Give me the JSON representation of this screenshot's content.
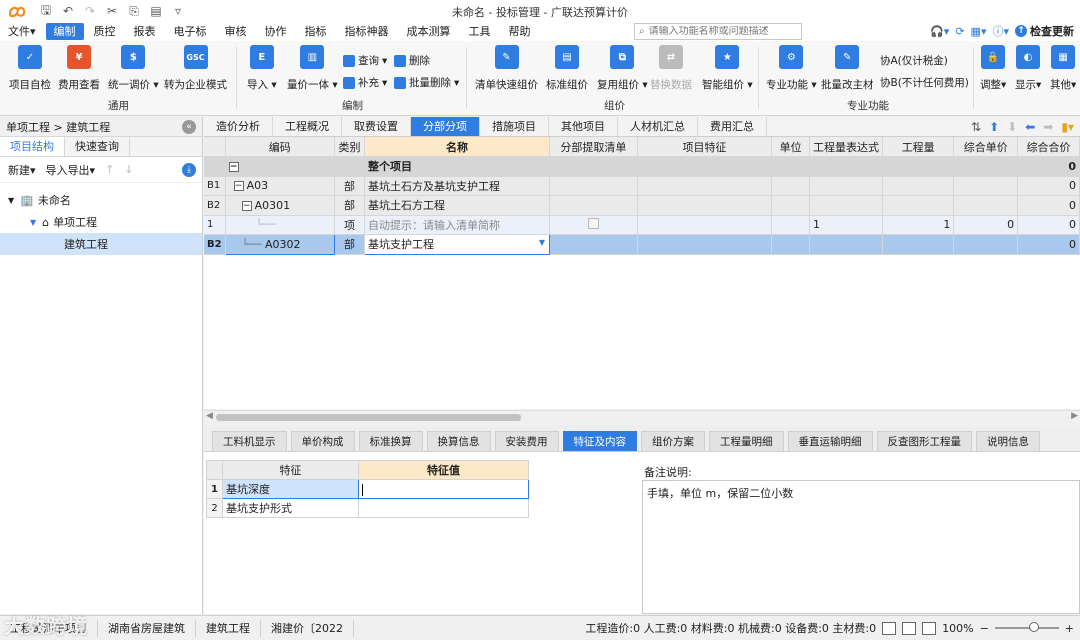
{
  "window": {
    "title": "未命名 - 投标管理 - 广联达预算计价"
  },
  "menu": {
    "items": [
      "文件",
      "编制",
      "质控",
      "报表",
      "电子标",
      "审核",
      "协作",
      "指标",
      "指标神器",
      "成本测算",
      "工具",
      "帮助"
    ],
    "file_suffix": "▾",
    "search_placeholder": "请输入功能名称或问题描述",
    "check_update": "检查更新"
  },
  "ribbon": {
    "buttons": {
      "self_check": "项目自检",
      "fee_view": "费用查看",
      "unify_price": "统一调价",
      "to_enterprise": "转为企业模式",
      "import": "导入",
      "qty_price": "量价一体",
      "quick_price": "清单快速组价",
      "std_price": "标准组价",
      "reuse_price": "复用组价",
      "replace_data": "替换数据",
      "smart_price": "智能组价",
      "pro_func": "专业功能",
      "batch_main": "批量改主材",
      "adjust": "调整",
      "display": "显示",
      "other": "其他"
    },
    "small": {
      "query": "查询",
      "delete": "删除",
      "supplement": "补充",
      "batch_delete": "批量删除",
      "co_a": "协A(仅计税金)",
      "co_b": "协B(不计任何费用)"
    },
    "groups": {
      "general": "通用",
      "edit": "编制",
      "pricing": "组价",
      "pro": "专业功能"
    },
    "icon_text": {
      "gsc": "GSC"
    }
  },
  "left": {
    "breadcrumb": "单项工程 > 建筑工程",
    "tabs": [
      "项目结构",
      "快速查询"
    ],
    "tools": {
      "new": "新建",
      "import_export": "导入导出"
    },
    "tree": {
      "root": "未命名",
      "single": "单项工程",
      "unit": "建筑工程"
    }
  },
  "main_tabs": [
    "造价分析",
    "工程概况",
    "取费设置",
    "分部分项",
    "措施项目",
    "其他项目",
    "人材机汇总",
    "费用汇总"
  ],
  "grid": {
    "headers": [
      "编码",
      "类别",
      "名称",
      "分部提取清单",
      "项目特征",
      "单位",
      "工程量表达式",
      "工程量",
      "综合单价",
      "综合合价"
    ],
    "rows": {
      "total": {
        "name": "整个项目",
        "total": "0"
      },
      "b1": {
        "no": "B1",
        "code": "A03",
        "type": "部",
        "name": "基坑土石方及基坑支护工程",
        "total": "0"
      },
      "b2": {
        "no": "B2",
        "code": "A0301",
        "type": "部",
        "name": "基坑土石方工程",
        "total": "0"
      },
      "item": {
        "no": "1",
        "type": "项",
        "name": "自动提示：请输入清单简称",
        "expr": "1",
        "qty": "1",
        "price": "0",
        "total": "0"
      },
      "sel": {
        "no": "B2",
        "code": "A0302",
        "type": "部",
        "name": "基坑支护工程",
        "total": "0"
      }
    }
  },
  "bottom_tabs": [
    "工料机显示",
    "单价构成",
    "标准换算",
    "换算信息",
    "安装费用",
    "特征及内容",
    "组价方案",
    "工程量明细",
    "垂直运输明细",
    "反查图形工程量",
    "说明信息"
  ],
  "feature": {
    "headers": [
      "特征",
      "特征值"
    ],
    "rows": [
      {
        "no": "1",
        "name": "基坑深度",
        "value": ""
      },
      {
        "no": "2",
        "name": "基坑支护形式",
        "value": ""
      }
    ],
    "note_label": "备注说明:",
    "note_text": "手填，单位 m，保留二位小数"
  },
  "status": {
    "segments": [
      "工程量清单项目",
      "湖南省房屋建筑",
      "建筑工程",
      "湘建价〔2022"
    ],
    "costs": "工程造价:0  人工费:0  材料费:0  机械费:0  设备费:0  主材费:0",
    "zoom": "100%"
  },
  "watermark": "大数跨境",
  "colors": {
    "accent": "#2f7de1",
    "selected_row": "#a8c8ee",
    "header_highlight": "#fde8c8"
  }
}
